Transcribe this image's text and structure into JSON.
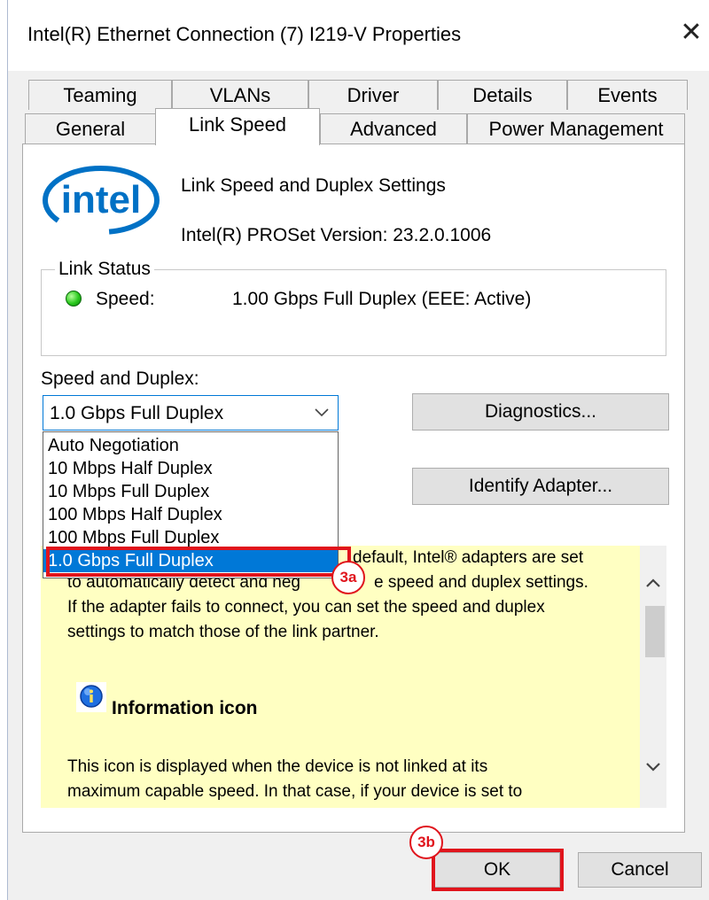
{
  "window": {
    "title": "Intel(R) Ethernet Connection (7) I219-V Properties"
  },
  "tabs": {
    "row1": [
      "Teaming",
      "VLANs",
      "Driver",
      "Details",
      "Events"
    ],
    "row2": [
      "General",
      "Link Speed",
      "Advanced",
      "Power Management"
    ],
    "active": "Link Speed"
  },
  "header": {
    "logo_text": "intel",
    "title": "Link Speed and Duplex Settings",
    "version": "Intel(R) PROSet Version: 23.2.0.1006"
  },
  "link_status": {
    "group_label": "Link Status",
    "speed_label": "Speed:",
    "speed_value": "1.00 Gbps Full Duplex (EEE: Active)",
    "led_color": "#28c81c"
  },
  "speed_duplex": {
    "label": "Speed and Duplex:",
    "selected": "1.0 Gbps Full Duplex",
    "options": [
      "Auto Negotiation",
      "10 Mbps Half Duplex",
      "10 Mbps Full Duplex",
      "100 Mbps Half Duplex",
      "100 Mbps Full Duplex",
      "1.0 Gbps Full Duplex"
    ]
  },
  "buttons": {
    "diagnostics": "Diagnostics...",
    "identify": "Identify Adapter...",
    "ok": "OK",
    "cancel": "Cancel"
  },
  "help": {
    "lines": [
      "default, Intel® adapters are set",
      "to automatically detect and neg",
      "e speed and duplex settings.",
      "If the adapter fails to connect, you can set the speed and duplex",
      "settings to match those of the link partner."
    ],
    "info_title": "Information icon",
    "info_lines": [
      "This icon is displayed when the device is not linked at its",
      "maximum capable speed. In that case, if your device is set to"
    ]
  },
  "callouts": {
    "a": "3a",
    "b": "3b",
    "color": "#e0141c"
  },
  "colors": {
    "accent": "#0078d7",
    "help_bg": "#ffffc2",
    "selection": "#0078d7"
  }
}
